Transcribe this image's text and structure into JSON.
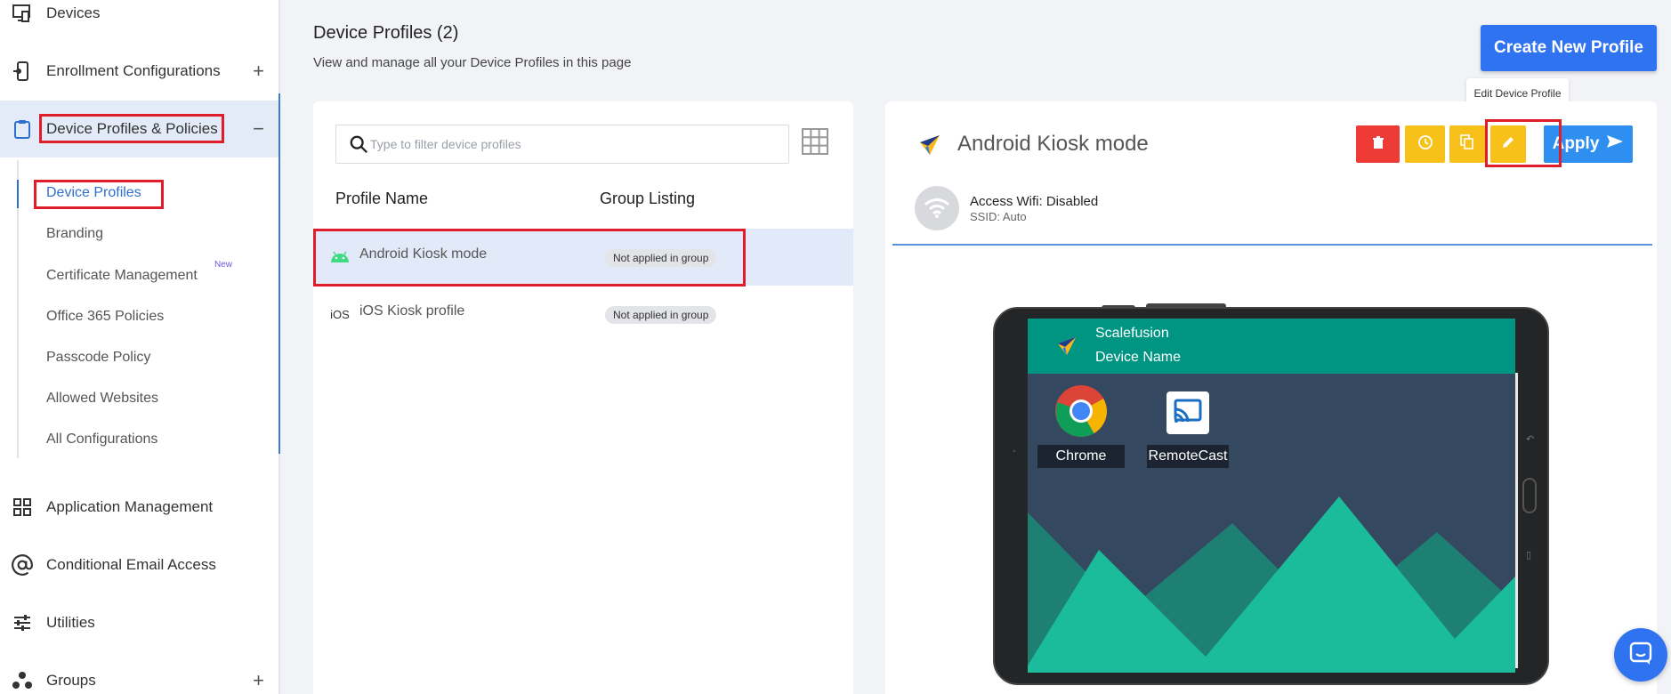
{
  "sidebar": {
    "items": [
      {
        "label": "Devices",
        "icon": "devices-icon"
      },
      {
        "label": "Enrollment Configurations",
        "icon": "enrollment-icon",
        "toggle": "+"
      },
      {
        "label": "Device Profiles & Policies",
        "icon": "clipboard-icon",
        "toggle": "−"
      },
      {
        "label": "Application Management",
        "icon": "apps-grid-icon"
      },
      {
        "label": "Conditional Email Access",
        "icon": "at-sign-icon"
      },
      {
        "label": "Utilities",
        "icon": "sliders-icon"
      },
      {
        "label": "Groups",
        "icon": "groups-icon",
        "toggle": "+"
      }
    ],
    "sub_items": [
      {
        "label": "Device Profiles"
      },
      {
        "label": "Branding"
      },
      {
        "label": "Certificate Management",
        "badge": "New"
      },
      {
        "label": "Office 365 Policies"
      },
      {
        "label": "Passcode Policy"
      },
      {
        "label": "Allowed Websites"
      },
      {
        "label": "All Configurations"
      }
    ]
  },
  "header": {
    "title": "Device Profiles (2)",
    "subtitle": "View and manage all your Device Profiles in this page",
    "create_button": "Create New Profile",
    "tooltip": "Edit Device Profile"
  },
  "list": {
    "search_placeholder": "Type to filter device profiles",
    "columns": [
      "Profile Name",
      "Group Listing"
    ],
    "rows": [
      {
        "name": "Android Kiosk mode",
        "platform": "android-icon",
        "group": "Not applied in group",
        "selected": true
      },
      {
        "name": "iOS Kiosk profile",
        "platform": "iOS",
        "group": "Not applied in group",
        "selected": false
      }
    ]
  },
  "detail": {
    "title": "Android Kiosk mode",
    "apply_label": "Apply",
    "wifi_label": "Access Wifi: Disabled",
    "wifi_ssid": "SSID: Auto",
    "preview": {
      "app_name": "Scalefusion",
      "device_name": "Device Name",
      "apps": [
        {
          "label": "Chrome",
          "icon": "chrome-icon"
        },
        {
          "label": "RemoteCast",
          "icon": "remotecast-icon"
        }
      ]
    }
  },
  "colors": {
    "accent": "#2f73f1",
    "delete": "#ef3b36",
    "warning": "#f8c11a",
    "kiosk_bar": "#009482",
    "highlight": "#e01e2b"
  }
}
